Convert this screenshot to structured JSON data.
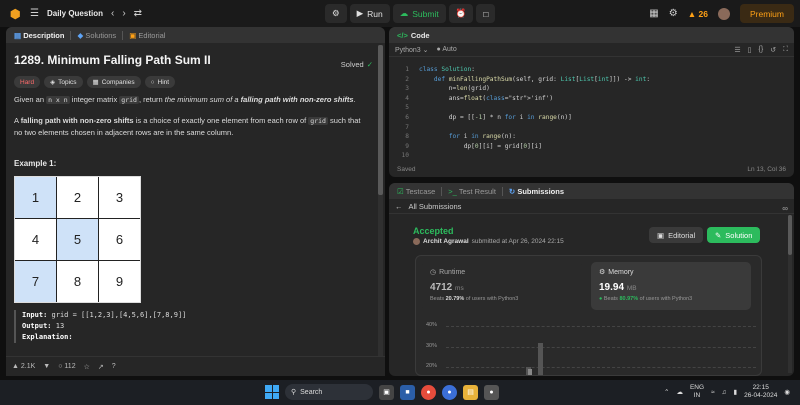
{
  "topbar": {
    "title": "Daily Question",
    "run_label": "Run",
    "submit_label": "Submit",
    "streak": "26",
    "premium_label": "Premium"
  },
  "description": {
    "tabs": [
      "Description",
      "Solutions",
      "Editorial"
    ],
    "title": "1289. Minimum Falling Path Sum II",
    "solved": "Solved",
    "tags": [
      "Hard",
      "Topics",
      "Companies",
      "Hint"
    ],
    "p1_a": "Given an ",
    "p1_code1": "n x n",
    "p1_b": " integer matrix ",
    "p1_code2": "grid",
    "p1_c": ", return ",
    "p1_em": "the minimum sum of a ",
    "p1_strong": "falling path with non-zero shifts",
    "p1_d": ".",
    "p2_strong": "falling path with non-zero shifts",
    "p2_a": "A ",
    "p2_b": " is a choice of exactly one element from each row of ",
    "p2_code": "grid",
    "p2_c": " such that no two elements chosen in adjacent rows are in the same column.",
    "example_title": "Example 1:",
    "grid": [
      [
        "1",
        "2",
        "3"
      ],
      [
        "4",
        "5",
        "6"
      ],
      [
        "7",
        "8",
        "9"
      ]
    ],
    "input_label": "Input:",
    "input_value": "grid = [[1,2,3],[4,5,6],[7,8,9]]",
    "output_label": "Output:",
    "output_value": "13",
    "explanation_label": "Explanation:",
    "likes": "2.1K",
    "comments": "112"
  },
  "code": {
    "title": "Code",
    "language": "Python3",
    "mode": "Auto",
    "line_numbers": [
      "1",
      "2",
      "3",
      "4",
      "5",
      "6",
      "7",
      "8",
      "9",
      "10"
    ],
    "lines": [
      "class Solution:",
      "    def minFallingPathSum(self, grid: List[List[int]]) -> int:",
      "        n=len(grid)",
      "        ans=float('inf')",
      "",
      "        dp = [[-1] * n for i in range(n)]",
      "",
      "        for i in range(n):",
      "            dp[0][i] = grid[0][i]",
      ""
    ],
    "status": "Saved",
    "cursor": "Ln 13, Col 36"
  },
  "submissions": {
    "tabs": [
      "Testcase",
      "Test Result",
      "Submissions"
    ],
    "all_label": "All Submissions",
    "result": "Accepted",
    "user": "Archit Agrawal",
    "submitted_text": " submitted at Apr 26, 2024 22:15",
    "editorial_label": "Editorial",
    "solution_label": "Solution",
    "runtime_title": "Runtime",
    "runtime_value": "4712",
    "runtime_unit": "ms",
    "runtime_beats_a": "Beats ",
    "runtime_beats_pct": "20.79%",
    "runtime_beats_b": " of users with Python3",
    "memory_title": "Memory",
    "memory_value": "19.94",
    "memory_unit": "MB",
    "memory_beats_a": "Beats ",
    "memory_beats_pct": "80.97%",
    "memory_beats_b": " of users with Python3",
    "axis_labels": [
      "40%",
      "30%",
      "20%"
    ]
  },
  "taskbar": {
    "search_placeholder": "Search",
    "lang_top": "ENG",
    "lang_bottom": "IN",
    "time": "22:15",
    "date": "26-04-2024"
  },
  "colors": {
    "accent_green": "#2cbb5d",
    "accent_orange": "#ffa116",
    "hard_red": "#ff6b6b",
    "link_blue": "#5ea4f6"
  }
}
